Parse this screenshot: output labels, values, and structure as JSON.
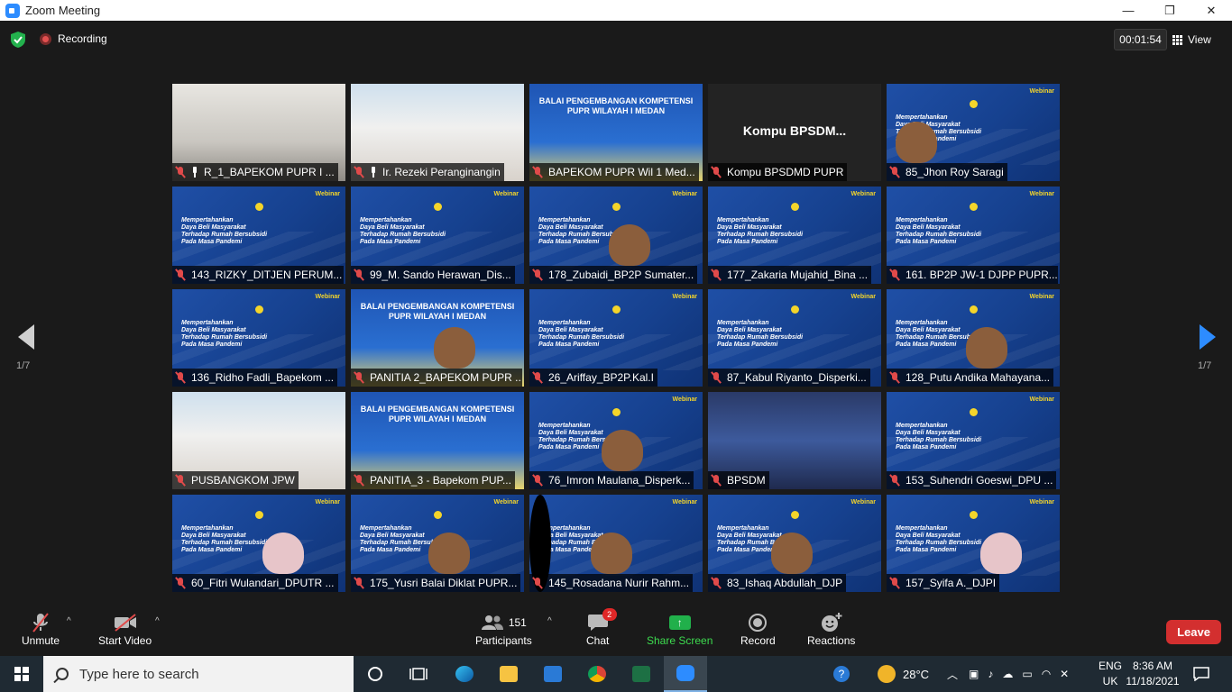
{
  "window": {
    "title": "Zoom Meeting",
    "minimize": "—",
    "maximize": "❐",
    "close": "✕"
  },
  "topbar": {
    "recording_label": "Recording",
    "timer": "00:01:54",
    "view_label": "View"
  },
  "pager": {
    "left": "1/7",
    "right": "1/7"
  },
  "tiles": [
    {
      "name": "R_1_BAPEKOM PUPR I ...",
      "kind": "room",
      "pinned": true
    },
    {
      "name": "Ir. Rezeki Peranginangin",
      "kind": "office",
      "pinned": true
    },
    {
      "name": "BAPEKOM PUPR Wil 1 Med...",
      "kind": "banner",
      "pinned": false
    },
    {
      "name": "Kompu BPSDMD PUPR",
      "kind": "dark",
      "pinned": false,
      "center": "Kompu  BPSDM..."
    },
    {
      "name": "85_Jhon Roy Saragi",
      "kind": "webinar",
      "pinned": false
    },
    {
      "name": "143_RIZKY_DITJEN PERUM...",
      "kind": "webinar",
      "pinned": false
    },
    {
      "name": "99_M. Sando Herawan_Dis...",
      "kind": "webinar",
      "pinned": false
    },
    {
      "name": "178_Zubaidi_BP2P Sumater...",
      "kind": "webinar",
      "pinned": false
    },
    {
      "name": "177_Zakaria Mujahid_Bina ...",
      "kind": "webinar",
      "pinned": false
    },
    {
      "name": "161. BP2P JW-1 DJPP PUPR...",
      "kind": "webinar",
      "pinned": false
    },
    {
      "name": "136_Ridho Fadli_Bapekom ...",
      "kind": "webinar",
      "pinned": false
    },
    {
      "name": "PANITIA 2_BAPEKOM PUPR ...",
      "kind": "banner",
      "pinned": false
    },
    {
      "name": "26_Ariffay_BP2P.Kal.I",
      "kind": "webinar",
      "pinned": false
    },
    {
      "name": "87_Kabul Riyanto_Disperki...",
      "kind": "webinar",
      "pinned": false
    },
    {
      "name": "128_Putu Andika Mahayana...",
      "kind": "webinar",
      "pinned": false
    },
    {
      "name": "PUSBANGKOM JPW",
      "kind": "office",
      "pinned": false
    },
    {
      "name": "PANITIA_3 - Bapekom PUP...",
      "kind": "banner",
      "pinned": false
    },
    {
      "name": "76_Imron Maulana_Disperk...",
      "kind": "webinar",
      "pinned": false
    },
    {
      "name": "BPSDM",
      "kind": "building",
      "pinned": false
    },
    {
      "name": "153_Suhendri Goeswi_DPU ...",
      "kind": "webinar",
      "pinned": false
    },
    {
      "name": "60_Fitri Wulandari_DPUTR ...",
      "kind": "webinar",
      "pinned": false
    },
    {
      "name": "175_Yusri Balai Diklat PUPR...",
      "kind": "webinar",
      "pinned": false
    },
    {
      "name": "145_Rosadana Nurir Rahm...",
      "kind": "webinar",
      "pinned": false
    },
    {
      "name": "83_Ishaq Abdullah_DJP",
      "kind": "webinar",
      "pinned": false
    },
    {
      "name": "157_Syifa A._DJPI",
      "kind": "webinar",
      "pinned": false
    }
  ],
  "slide": {
    "webinar_text": "Mempertahankan\nDaya Beli Masyarakat\nTerhadap Rumah Bersubsidi\nPada Masa Pandemi",
    "webinar_badge": "Webinar",
    "banner_text": "BALAI PENGEMBANGAN KOMPETENSI\nPUPR WILAYAH I MEDAN"
  },
  "toolbar": {
    "unmute": "Unmute",
    "start_video": "Start Video",
    "participants": "Participants",
    "participants_count": "151",
    "chat": "Chat",
    "chat_badge": "2",
    "share_screen": "Share Screen",
    "record": "Record",
    "reactions": "Reactions",
    "leave": "Leave",
    "caret": "^"
  },
  "taskbar": {
    "search_placeholder": "Type here to search",
    "weather": "28°C",
    "lang_top": "ENG",
    "lang_bottom": "UK",
    "time": "8:36 AM",
    "date": "11/18/2021"
  },
  "colors": {
    "accent": "#2d8cff",
    "leave": "#d32f2f",
    "share": "#21b04b",
    "mic_muted": "#e04a4a"
  }
}
